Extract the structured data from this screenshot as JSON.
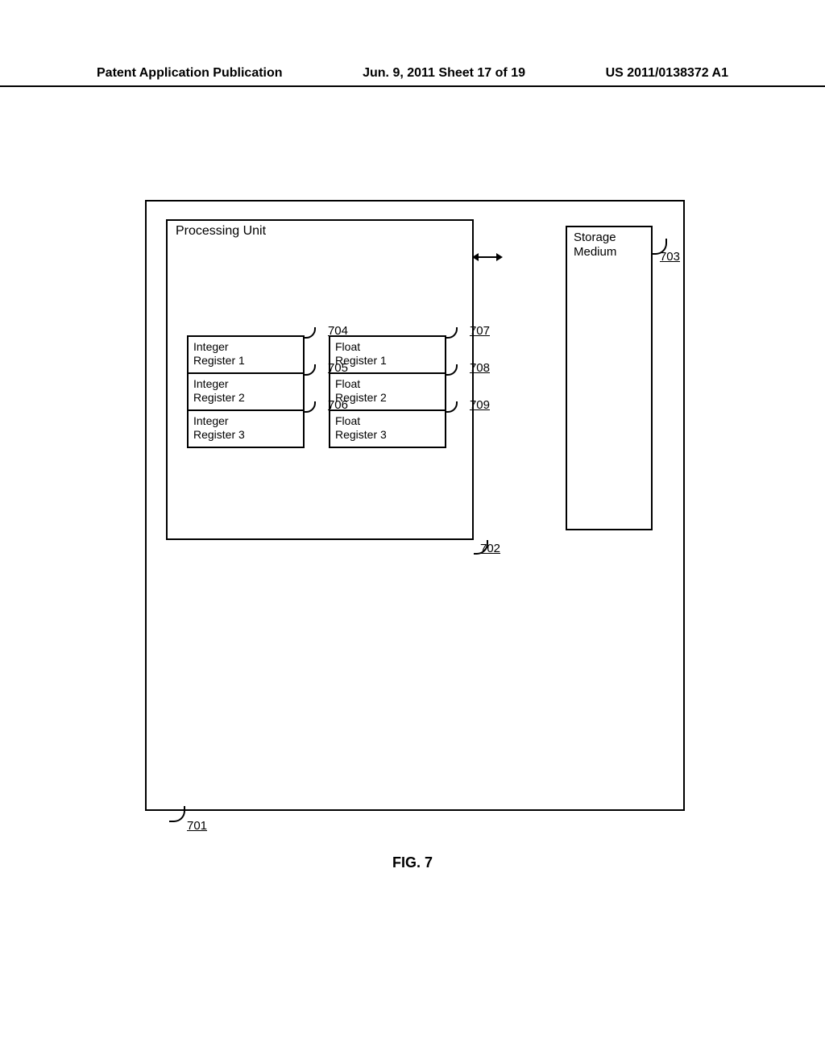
{
  "header": {
    "left": "Patent Application Publication",
    "center": "Jun. 9, 2011  Sheet 17 of 19",
    "right": "US 2011/0138372 A1"
  },
  "outer": {
    "ref": "701"
  },
  "processing_unit": {
    "title": "Processing Unit",
    "ref": "702",
    "int_registers": [
      {
        "label": "Integer\nRegister 1",
        "ref": "704"
      },
      {
        "label": "Integer\nRegister 2",
        "ref": "705"
      },
      {
        "label": "Integer\nRegister 3",
        "ref": "706"
      }
    ],
    "float_registers": [
      {
        "label": "Float\nRegister 1",
        "ref": "707"
      },
      {
        "label": "Float\nRegister 2",
        "ref": "708"
      },
      {
        "label": "Float\nRegister 3",
        "ref": "709"
      }
    ]
  },
  "storage": {
    "title": "Storage\nMedium",
    "ref": "703"
  },
  "figure_caption": "FIG. 7"
}
